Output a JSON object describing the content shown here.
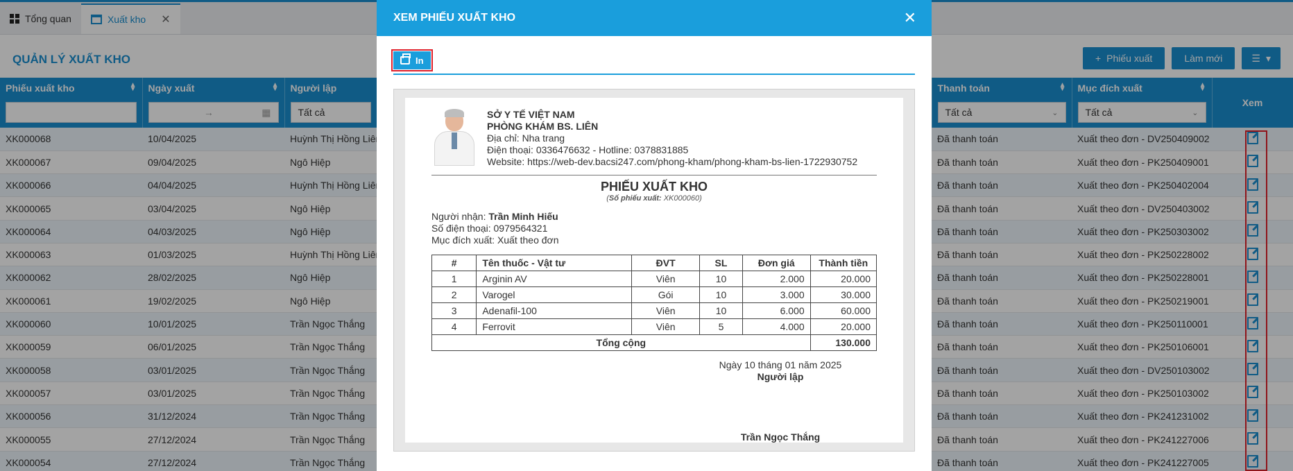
{
  "tabs": [
    {
      "label": "Tổng quan"
    },
    {
      "label": "Xuất kho"
    }
  ],
  "page": {
    "title": "QUẢN LÝ XUẤT KHO",
    "actions": {
      "add": "Phiếu xuất",
      "refresh": "Làm mới"
    }
  },
  "grid": {
    "columns": [
      "Phiếu xuất kho",
      "Ngày xuất",
      "Người lập",
      "Thanh toán",
      "Mục đích xuất",
      "Xem"
    ],
    "filters": {
      "date_sep": "→",
      "creator": "Tất cả",
      "payment": "Tất cả",
      "purpose": "Tất cả"
    },
    "rows": [
      {
        "code": "XK000068",
        "date": "10/04/2025",
        "creator": "Huỳnh Thị Hồng Liên",
        "payment": "Đã thanh toán",
        "purpose": "Xuất theo đơn - DV250409002"
      },
      {
        "code": "XK000067",
        "date": "09/04/2025",
        "creator": "Ngô Hiệp",
        "payment": "Đã thanh toán",
        "purpose": "Xuất theo đơn - PK250409001"
      },
      {
        "code": "XK000066",
        "date": "04/04/2025",
        "creator": "Huỳnh Thị Hồng Liên",
        "payment": "Đã thanh toán",
        "purpose": "Xuất theo đơn - PK250402004"
      },
      {
        "code": "XK000065",
        "date": "03/04/2025",
        "creator": "Ngô Hiệp",
        "payment": "Đã thanh toán",
        "purpose": "Xuất theo đơn - DV250403002"
      },
      {
        "code": "XK000064",
        "date": "04/03/2025",
        "creator": "Ngô Hiệp",
        "payment": "Đã thanh toán",
        "purpose": "Xuất theo đơn - PK250303002"
      },
      {
        "code": "XK000063",
        "date": "01/03/2025",
        "creator": "Huỳnh Thị Hồng Liên",
        "payment": "Đã thanh toán",
        "purpose": "Xuất theo đơn - PK250228002"
      },
      {
        "code": "XK000062",
        "date": "28/02/2025",
        "creator": "Ngô Hiệp",
        "payment": "Đã thanh toán",
        "purpose": "Xuất theo đơn - PK250228001"
      },
      {
        "code": "XK000061",
        "date": "19/02/2025",
        "creator": "Ngô Hiệp",
        "payment": "Đã thanh toán",
        "purpose": "Xuất theo đơn - PK250219001"
      },
      {
        "code": "XK000060",
        "date": "10/01/2025",
        "creator": "Trần Ngọc Thắng",
        "payment": "Đã thanh toán",
        "purpose": "Xuất theo đơn - PK250110001"
      },
      {
        "code": "XK000059",
        "date": "06/01/2025",
        "creator": "Trần Ngọc Thắng",
        "payment": "Đã thanh toán",
        "purpose": "Xuất theo đơn - PK250106001"
      },
      {
        "code": "XK000058",
        "date": "03/01/2025",
        "creator": "Trần Ngọc Thắng",
        "payment": "Đã thanh toán",
        "purpose": "Xuất theo đơn - DV250103002"
      },
      {
        "code": "XK000057",
        "date": "03/01/2025",
        "creator": "Trần Ngọc Thắng",
        "payment": "Đã thanh toán",
        "purpose": "Xuất theo đơn - PK250103002"
      },
      {
        "code": "XK000056",
        "date": "31/12/2024",
        "creator": "Trần Ngọc Thắng",
        "payment": "Đã thanh toán",
        "purpose": "Xuất theo đơn - PK241231002"
      },
      {
        "code": "XK000055",
        "date": "27/12/2024",
        "creator": "Trần Ngọc Thắng",
        "payment": "Đã thanh toán",
        "purpose": "Xuất theo đơn - PK241227006"
      },
      {
        "code": "XK000054",
        "date": "27/12/2024",
        "creator": "Trần Ngọc Thắng",
        "payment": "Đã thanh toán",
        "purpose": "Xuất theo đơn - PK241227005"
      }
    ]
  },
  "modal": {
    "title": "XEM PHIẾU XUẤT KHO",
    "print_label": "In",
    "clinic": {
      "line1": "SỞ Y TẾ VIỆT NAM",
      "line2": "PHÒNG KHÁM BS. LIÊN",
      "address": "Địa chỉ: Nha trang",
      "phone": "Điện thoại: 0336476632 - Hotline: 0378831885",
      "website": "Website: https://web-dev.bacsi247.com/phong-kham/phong-kham-bs-lien-1722930752"
    },
    "doc_title": "PHIẾU XUẤT KHO",
    "doc_no_label": "Số phiếu xuất:",
    "doc_no": "XK000060",
    "receiver_label": "Người nhận:",
    "receiver": "Trần Minh Hiếu",
    "phone_label": "Số điện thoại:",
    "phone": "0979564321",
    "purpose_label": "Mục đích xuất:",
    "purpose": "Xuất theo đơn",
    "item_headers": [
      "#",
      "Tên thuốc - Vật tư",
      "ĐVT",
      "SL",
      "Đơn giá",
      "Thành tiền"
    ],
    "items": [
      {
        "no": "1",
        "name": "Arginin AV",
        "unit": "Viên",
        "qty": "10",
        "price": "2.000",
        "amount": "20.000"
      },
      {
        "no": "2",
        "name": "Varogel",
        "unit": "Gói",
        "qty": "10",
        "price": "3.000",
        "amount": "30.000"
      },
      {
        "no": "3",
        "name": "Adenafil-100",
        "unit": "Viên",
        "qty": "10",
        "price": "6.000",
        "amount": "60.000"
      },
      {
        "no": "4",
        "name": "Ferrovit",
        "unit": "Viên",
        "qty": "5",
        "price": "4.000",
        "amount": "20.000"
      }
    ],
    "total_label": "Tổng cộng",
    "total": "130.000",
    "sign_date": "Ngày 10 tháng 01 năm 2025",
    "sign_role": "Người lập",
    "sign_name": "Trần Ngọc Thắng"
  }
}
